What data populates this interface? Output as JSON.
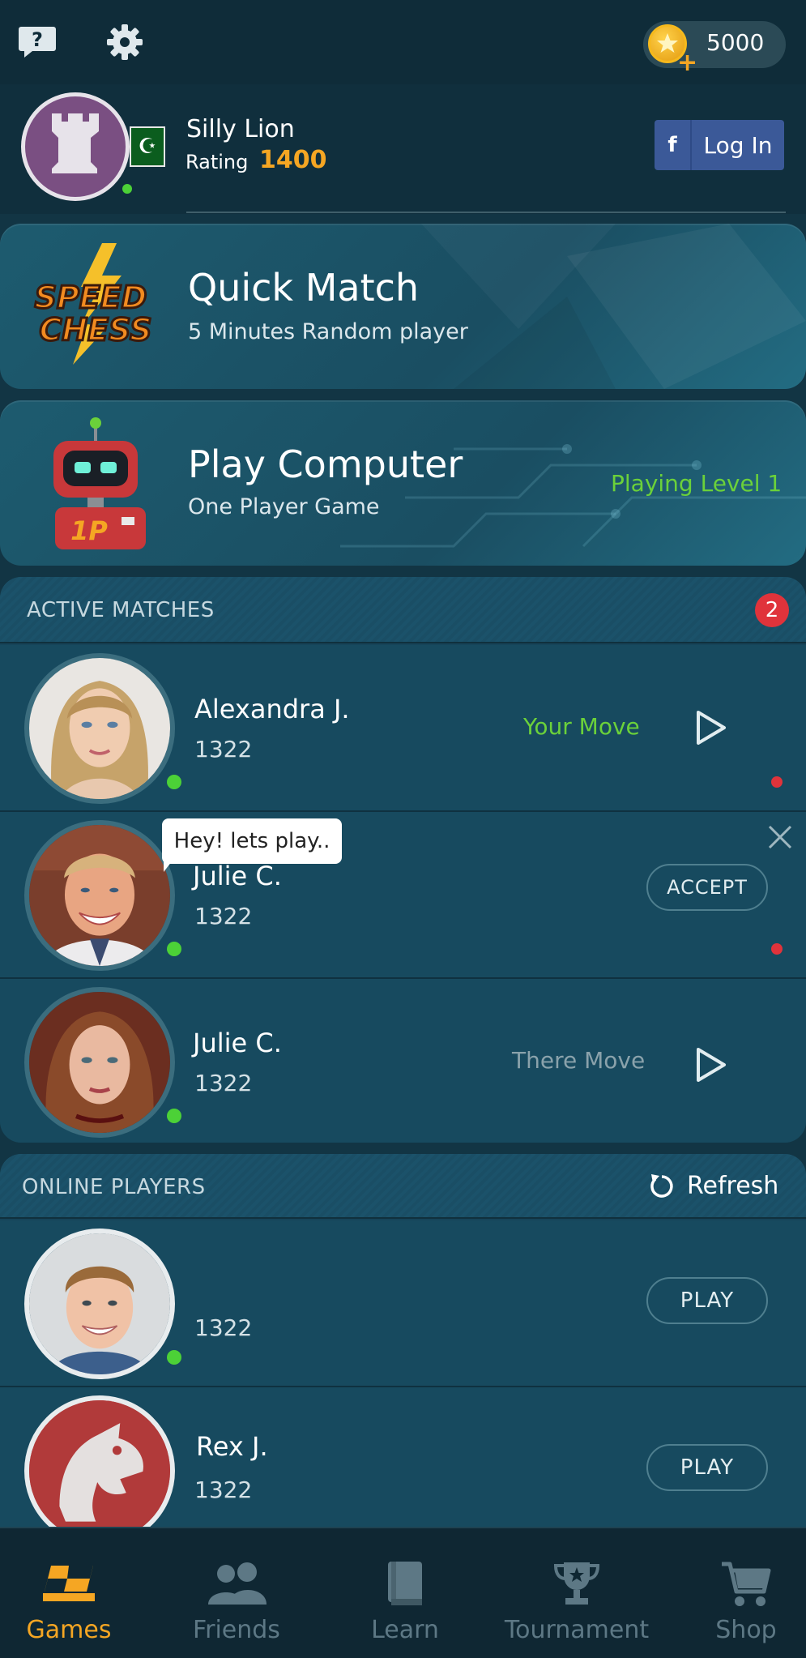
{
  "header": {
    "help_icon": "help-bubble-icon",
    "settings_icon": "gear-icon",
    "coins": "5000"
  },
  "profile": {
    "name": "Silly Lion",
    "rating_label": "Rating",
    "rating": "1400",
    "flag_icon": "pakistan-flag-icon",
    "login_label": "Log In",
    "login_icon": "f"
  },
  "quick_match": {
    "logo_top": "SPEED",
    "logo_bottom": "CHESS",
    "title": "Quick Match",
    "subtitle": "5 Minutes Random player"
  },
  "play_computer": {
    "robot_badge": "1P",
    "title": "Play Computer",
    "subtitle": "One Player Game",
    "level": "Playing Level 1"
  },
  "active_matches": {
    "title": "ACTIVE MATCHES",
    "badge": "2",
    "rows": [
      {
        "name": "Alexandra J.",
        "rating": "1322",
        "status": "Your Move"
      },
      {
        "name": "Julie C.",
        "rating": "1322",
        "action": "ACCEPT",
        "message": "Hey! lets play.."
      },
      {
        "name": "Julie C.",
        "rating": "1322",
        "status": "There Move"
      }
    ]
  },
  "online_players": {
    "title": "ONLINE PLAYERS",
    "refresh": "Refresh",
    "rows": [
      {
        "name": "",
        "rating": "1322",
        "action": "PLAY"
      },
      {
        "name": "Rex J.",
        "rating": "1322",
        "action": "PLAY"
      }
    ]
  },
  "nav": {
    "games": "Games",
    "friends": "Friends",
    "learn": "Learn",
    "tournament": "Tournament",
    "shop": "Shop"
  },
  "colors": {
    "accent_gold": "#f5a623",
    "green": "#6bd13a",
    "online": "#4cd137",
    "alert_red": "#e0333b",
    "facebook": "#3b5998"
  }
}
